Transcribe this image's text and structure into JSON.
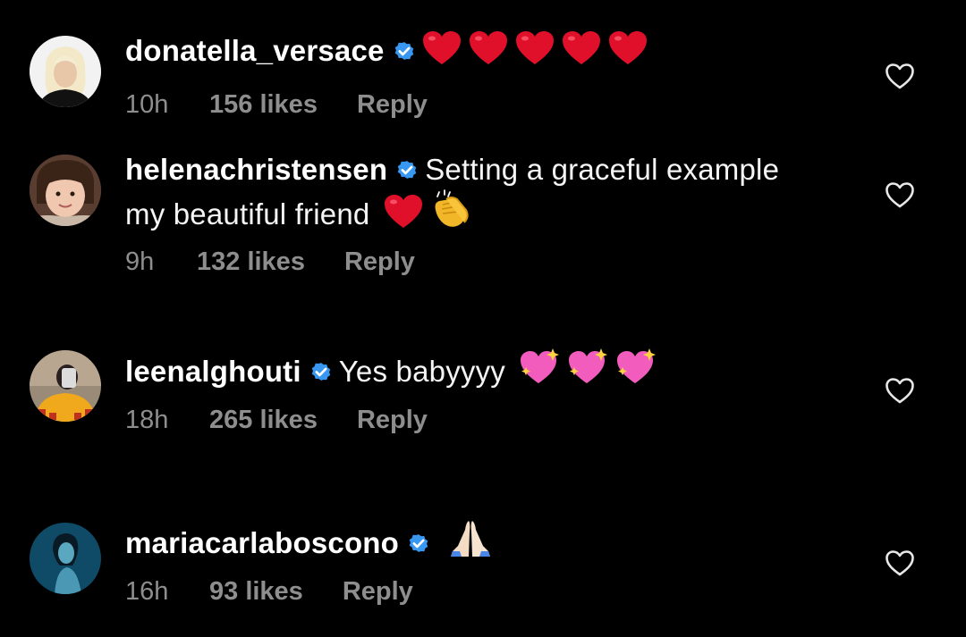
{
  "comments": [
    {
      "username": "donatella_versace",
      "text": "",
      "emoji": [
        "red-heart",
        "red-heart",
        "red-heart",
        "red-heart",
        "red-heart"
      ],
      "time": "10h",
      "likes": "156 likes",
      "reply": "Reply"
    },
    {
      "username": "helenachristensen",
      "text": "Setting a graceful example my beautiful friend",
      "emoji": [
        "red-heart",
        "clapping-hands"
      ],
      "time": "9h",
      "likes": "132 likes",
      "reply": "Reply"
    },
    {
      "username": "leenalghouti",
      "text": "Yes babyyyy",
      "emoji": [
        "sparkling-heart",
        "sparkling-heart",
        "sparkling-heart"
      ],
      "time": "18h",
      "likes": "265 likes",
      "reply": "Reply"
    },
    {
      "username": "mariacarlaboscono",
      "text": "",
      "emoji": [
        "folded-hands"
      ],
      "time": "16h",
      "likes": "93 likes",
      "reply": "Reply"
    }
  ],
  "colors": {
    "background": "#000000",
    "text": "#ffffff",
    "meta": "#8e8e8e",
    "verified": "#3897f0",
    "heart_emoji": "#e0102a"
  },
  "icons": {
    "verified": "verified-badge-icon",
    "like": "heart-outline-icon"
  }
}
